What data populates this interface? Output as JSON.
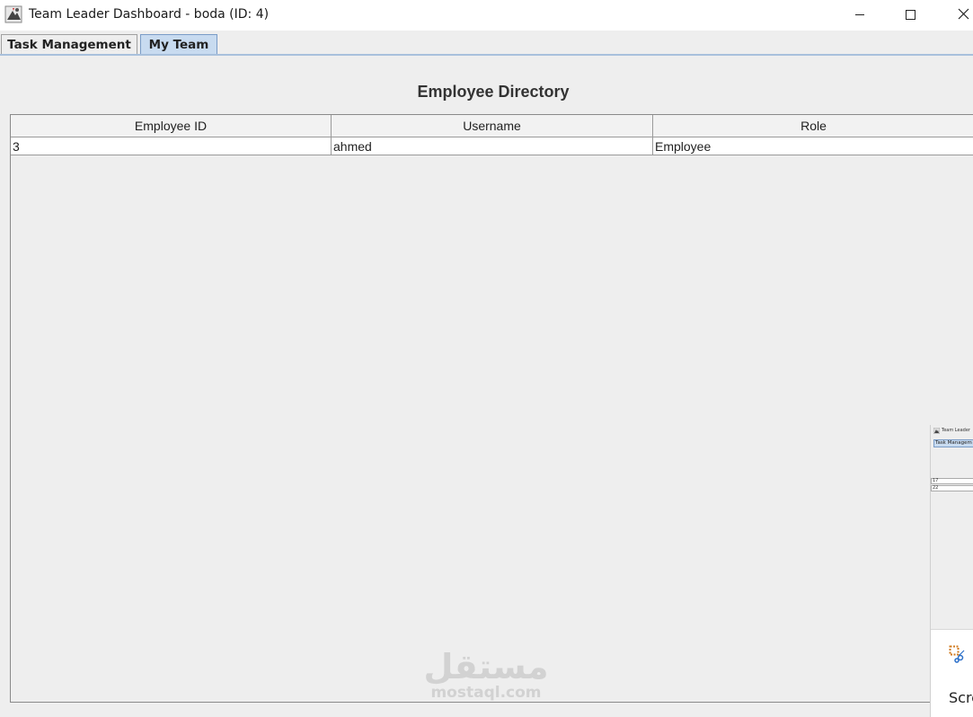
{
  "window": {
    "title": "Team Leader Dashboard - boda (ID: 4)"
  },
  "tabs": [
    {
      "label": "Task Management",
      "selected": false
    },
    {
      "label": "My Team",
      "selected": true
    }
  ],
  "main": {
    "heading": "Employee Directory",
    "table": {
      "columns": [
        "Employee ID",
        "Username",
        "Role"
      ],
      "rows": [
        [
          "3",
          "ahmed",
          "Employee"
        ]
      ]
    }
  },
  "watermark": {
    "arabic": "مستقل",
    "latin": "mostaql.com"
  },
  "snip_popup": {
    "thumb_title": "Team Leader",
    "thumb_tab": "Task Managem",
    "thumb_rows": [
      "17",
      "22"
    ],
    "text": "Scre"
  },
  "colors": {
    "selected_tab": "#c8dbf0",
    "tab_border": "#7a9cc7",
    "panel_bg": "#eeeeee"
  }
}
